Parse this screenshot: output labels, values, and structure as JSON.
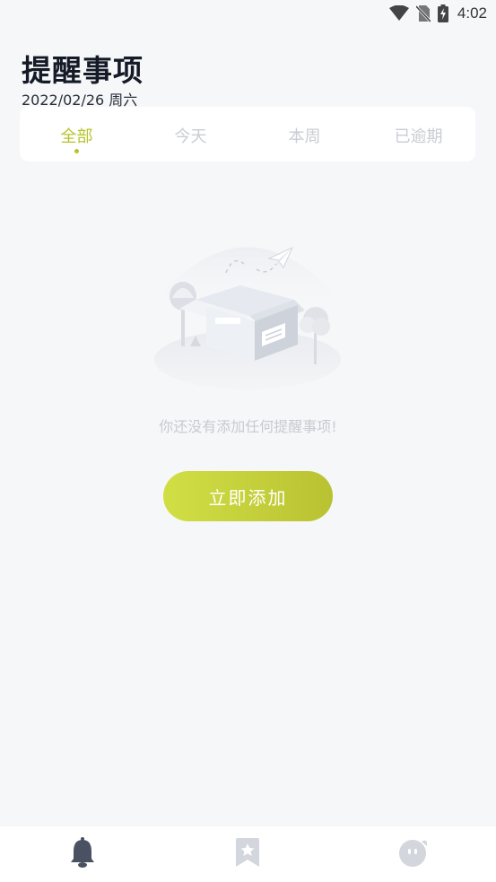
{
  "status_bar": {
    "time": "4:02",
    "icons": [
      "wifi-icon",
      "no-sim-icon",
      "battery-charging-icon"
    ]
  },
  "header": {
    "title": "提醒事项",
    "date": "2022/02/26 周六"
  },
  "tabs": [
    {
      "label": "全部",
      "active": true
    },
    {
      "label": "今天",
      "active": false
    },
    {
      "label": "本周",
      "active": false
    },
    {
      "label": "已逾期",
      "active": false
    }
  ],
  "empty_state": {
    "illustration": "empty-box-illustration",
    "message": "你还没有添加任何提醒事项!"
  },
  "add_button": {
    "label": "立即添加"
  },
  "bottom_nav": {
    "items": [
      {
        "icon": "bell-icon",
        "active": true
      },
      {
        "icon": "bookmark-star-icon",
        "active": false
      },
      {
        "icon": "face-icon",
        "active": false
      }
    ]
  },
  "colors": {
    "accent": "#b7c32c",
    "background": "#f6f7f9",
    "inactive": "#c9ccd3"
  }
}
